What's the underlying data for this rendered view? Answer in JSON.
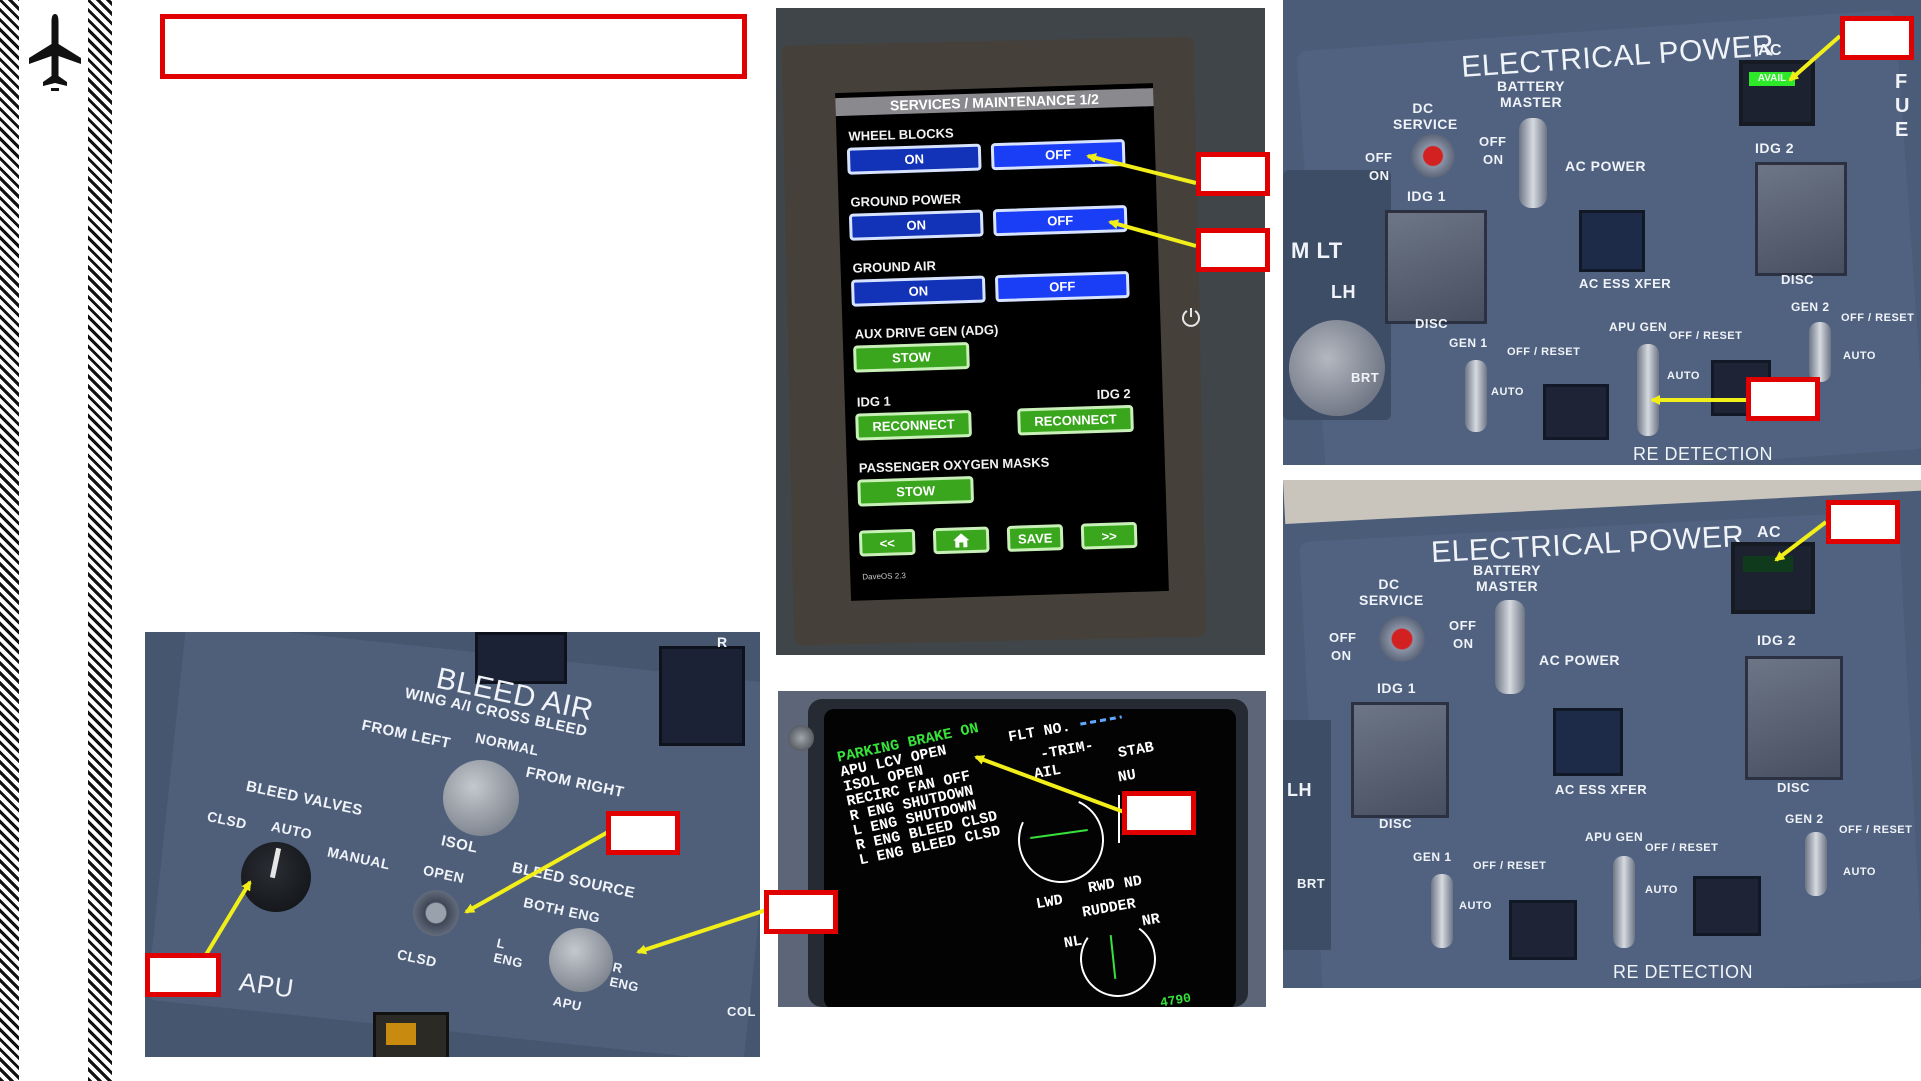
{
  "slide": {
    "sidebar": {
      "icon": "airplane-icon"
    },
    "title_box": ""
  },
  "tablet": {
    "header": "SERVICES / MAINTENANCE 1/2",
    "wheel_blocks": {
      "label": "WHEEL BLOCKS",
      "on": "ON",
      "off": "OFF"
    },
    "ground_power": {
      "label": "GROUND POWER",
      "on": "ON",
      "off": "OFF"
    },
    "ground_air": {
      "label": "GROUND AIR",
      "on": "ON",
      "off": "OFF"
    },
    "adg": {
      "label": "AUX DRIVE GEN (ADG)",
      "button": "STOW"
    },
    "idg1": {
      "label": "IDG 1",
      "button": "RECONNECT"
    },
    "idg2": {
      "label": "IDG 2",
      "button": "RECONNECT"
    },
    "oxygen": {
      "label": "PASSENGER OXYGEN MASKS",
      "button": "STOW"
    },
    "nav": {
      "prev": "<<",
      "home": "home-icon",
      "save": "SAVE",
      "next": ">>"
    },
    "footer": "DaveOS 2.3"
  },
  "elec_top": {
    "title": "ELECTRICAL POWER",
    "ac": "AC",
    "avail": "AVAIL",
    "dc_service": "DC SERVICE",
    "battery_master": "BATTERY MASTER",
    "off": "OFF",
    "on": "ON",
    "ac_power": "AC POWER",
    "idg1": "IDG 1",
    "idg2": "IDG 2",
    "disc": "DISC",
    "ac_ess_xfer": "AC ESS XFER",
    "gen1": "GEN 1",
    "gen2": "GEN 2",
    "apu_gen": "APU GEN",
    "off_reset": "OFF / RESET",
    "auto": "AUTO",
    "side_lt": "M LT",
    "side_lh": "LH",
    "brt": "BRT",
    "bottom": "RE DETECTION",
    "edge": "F U E"
  },
  "elec_bottom": {
    "title": "ELECTRICAL POWER",
    "ac": "AC",
    "dc_service": "DC SERVICE",
    "battery_master": "BATTERY MASTER",
    "off": "OFF",
    "on": "ON",
    "ac_power": "AC POWER",
    "idg1": "IDG 1",
    "idg2": "IDG 2",
    "disc": "DISC",
    "ac_ess_xfer": "AC ESS XFER",
    "gen1": "GEN 1",
    "gen2": "GEN 2",
    "apu_gen": "APU GEN",
    "off_reset": "OFF / RESET",
    "auto": "AUTO",
    "side_lh": "LH",
    "brt": "BRT",
    "bottom": "RE DETECTION"
  },
  "bleed": {
    "title": "BLEED AIR",
    "wing_ai": "WING A/I CROSS BLEED",
    "normal": "NORMAL",
    "from_left": "FROM LEFT",
    "from_right": "FROM RIGHT",
    "bleed_valves": "BLEED VALVES",
    "clsd": "CLSD",
    "auto": "AUTO",
    "manual": "MANUAL",
    "isol": "ISOL",
    "open": "OPEN",
    "isol_clsd": "CLSD",
    "bleed_source": "BLEED SOURCE",
    "both_eng": "BOTH ENG",
    "l_eng": "L ENG",
    "r_eng": "R ENG",
    "apu_src": "APU",
    "apu": "APU",
    "r": "R",
    "col": "COL"
  },
  "eicas": {
    "status_lines": [
      "PARKING BRAKE ON",
      "APU LCV OPEN",
      "ISOL OPEN",
      "RECIRC FAN OFF",
      "R ENG SHUTDOWN",
      "L ENG SHUTDOWN",
      "R ENG BLEED CLSD",
      "L ENG BLEED CLSD"
    ],
    "flt_no": "FLT NO.",
    "trim": "-TRIM-",
    "ail": "AIL",
    "stab": "STAB",
    "nu": "NU",
    "nd": "ND",
    "lwd": "LWD",
    "rwd": "RWD",
    "rudder": "RUDDER",
    "nl": "NL",
    "nr": "NR",
    "value": "4790"
  },
  "colors": {
    "callout_border": "#e00000",
    "arrow": "#f2ee1a",
    "eicas_green": "#37e23a",
    "eicas_white": "#ffffff",
    "avail_green": "#2ee82a"
  }
}
